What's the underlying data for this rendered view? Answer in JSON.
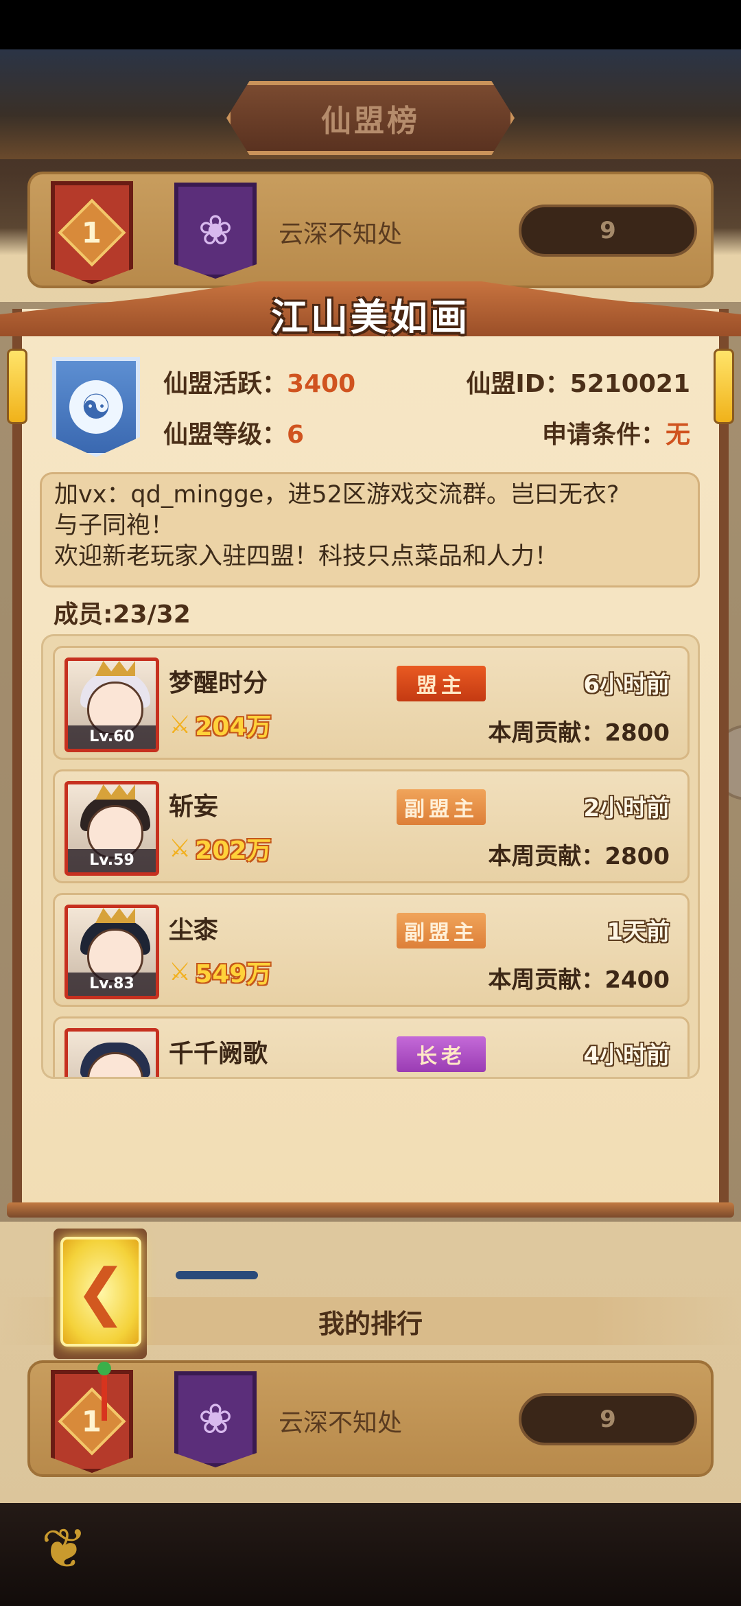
{
  "background": {
    "ribbon_title": "仙盟榜",
    "top_rank_row": {
      "rank": "1",
      "guild_name": "云深不知处",
      "score": "9"
    },
    "my_rank_label": "我的排行",
    "my_rank_row": {
      "rank": "1",
      "guild_name": "云深不知处",
      "score": "9"
    }
  },
  "panel": {
    "title": "江山美如画",
    "activity_label": "仙盟活跃：",
    "activity_value": "3400",
    "id_label": "仙盟ID：",
    "id_value": "5210021",
    "level_label": "仙盟等级：",
    "level_value": "6",
    "requirement_label": "申请条件：",
    "requirement_value": "无",
    "notice_line1": "加vx：qd_mingge，进52区游戏交流群。岂曰无衣?",
    "notice_line2": "与子同袍！",
    "notice_line3": "欢迎新老玩家入驻四盟！科技只点菜品和人力！",
    "member_count": "成员:23/32",
    "members": [
      {
        "name": "梦醒时分",
        "level": "Lv.60",
        "power": "204万",
        "role": "盟主",
        "last_seen": "6小时前",
        "contribution": "本周贡献：2800"
      },
      {
        "name": "斩妄",
        "level": "Lv.59",
        "power": "202万",
        "role": "副盟主",
        "last_seen": "2小时前",
        "contribution": "本周贡献：2800"
      },
      {
        "name": "尘桼",
        "level": "Lv.83",
        "power": "549万",
        "role": "副盟主",
        "last_seen": "1天前",
        "contribution": "本周贡献：2400"
      },
      {
        "name": "千千阙歌",
        "role": "长老",
        "last_seen": "4小时前"
      }
    ]
  },
  "icons": {
    "back": "chevron-left-icon",
    "power": "crossed-swords-icon",
    "guild_flag": "lotus-icon",
    "guild_emblem": "yin-yang-icon"
  },
  "colors": {
    "accent_orange": "#d0531f",
    "leader_badge": "#e95a22",
    "deputy_badge": "#f0a45a",
    "elder_badge": "#c46ad8"
  }
}
